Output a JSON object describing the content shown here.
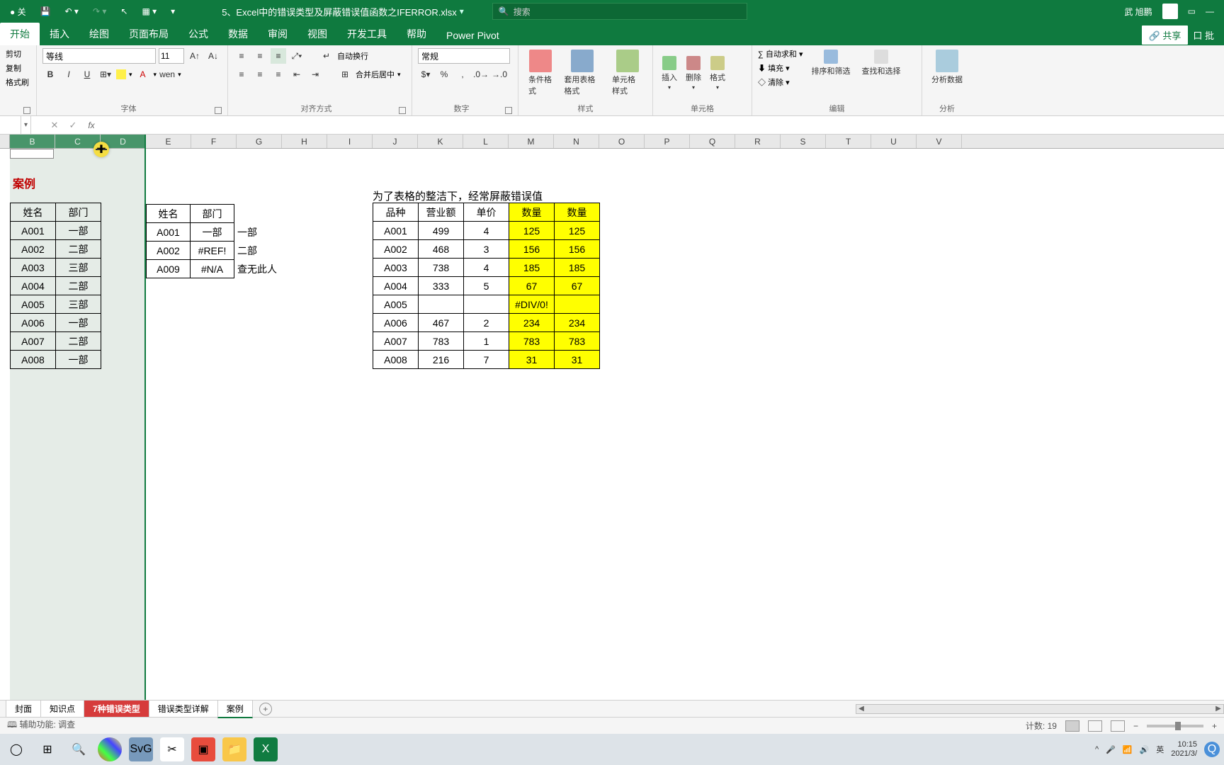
{
  "titlebar": {
    "filename": "5、Excel中的错误类型及屏蔽错误值函数之IFERROR.xlsx",
    "search_placeholder": "搜索",
    "username": "武 旭鹏"
  },
  "ribbon_tabs": [
    "开始",
    "插入",
    "绘图",
    "页面布局",
    "公式",
    "数据",
    "审阅",
    "视图",
    "开发工具",
    "帮助",
    "Power Pivot"
  ],
  "share_label": "共享",
  "insert_right_label": "口 批",
  "clipboard": {
    "cut": "剪切",
    "copy": "复制",
    "paint": "格式刷"
  },
  "font_group": {
    "label": "字体",
    "font_name": "等线",
    "font_size": "11",
    "bold": "B",
    "italic": "I",
    "underline": "U",
    "wen": "wen"
  },
  "align_group": {
    "label": "对齐方式",
    "wrap": "自动换行",
    "merge": "合并后居中"
  },
  "number_group": {
    "label": "数字",
    "format": "常规"
  },
  "styles_group": {
    "label": "样式",
    "cond": "条件格式",
    "tablefmt": "套用表格格式",
    "cellstyle": "单元格样式"
  },
  "cells_group": {
    "label": "单元格",
    "insert": "插入",
    "delete": "删除",
    "format": "格式"
  },
  "editing_group": {
    "label": "编辑",
    "autosum": "自动求和",
    "fill": "填充",
    "clear": "清除",
    "sort": "排序和筛选",
    "find": "查找和选择"
  },
  "analysis_group": {
    "label": "分析",
    "analyze": "分析数据"
  },
  "columns": [
    "B",
    "C",
    "D",
    "E",
    "F",
    "G",
    "H",
    "I",
    "J",
    "K",
    "L",
    "M",
    "N",
    "O",
    "P",
    "Q",
    "R",
    "S",
    "T",
    "U",
    "V"
  ],
  "case_label": "案例",
  "table1": {
    "headers": [
      "姓名",
      "部门"
    ],
    "rows": [
      [
        "A001",
        "一部"
      ],
      [
        "A002",
        "二部"
      ],
      [
        "A003",
        "三部"
      ],
      [
        "A004",
        "二部"
      ],
      [
        "A005",
        "三部"
      ],
      [
        "A006",
        "一部"
      ],
      [
        "A007",
        "二部"
      ],
      [
        "A008",
        "一部"
      ]
    ]
  },
  "table2": {
    "headers": [
      "姓名",
      "部门"
    ],
    "rows": [
      [
        "A001",
        "一部",
        "一部"
      ],
      [
        "A002",
        "#REF!",
        "二部"
      ],
      [
        "A009",
        "#N/A",
        "查无此人"
      ]
    ]
  },
  "banner": "为了表格的整洁下，经常屏蔽错误值",
  "table3": {
    "headers": [
      "品种",
      "营业额",
      "单价",
      "数量",
      "数量"
    ],
    "rows": [
      [
        "A001",
        "499",
        "4",
        "125",
        "125"
      ],
      [
        "A002",
        "468",
        "3",
        "156",
        "156"
      ],
      [
        "A003",
        "738",
        "4",
        "185",
        "185"
      ],
      [
        "A004",
        "333",
        "5",
        "67",
        "67"
      ],
      [
        "A005",
        "",
        "",
        "#DIV/0!",
        ""
      ],
      [
        "A006",
        "467",
        "2",
        "234",
        "234"
      ],
      [
        "A007",
        "783",
        "1",
        "783",
        "783"
      ],
      [
        "A008",
        "216",
        "7",
        "31",
        "31"
      ]
    ]
  },
  "sheet_tabs": [
    "封面",
    "知识点",
    "7种错误类型",
    "错误类型详解",
    "案例"
  ],
  "status": {
    "accessibility": "辅助功能: 调查",
    "count_label": "计数:",
    "count": "19"
  },
  "taskbar": {
    "time": "10:15",
    "date": "2021/3/"
  }
}
